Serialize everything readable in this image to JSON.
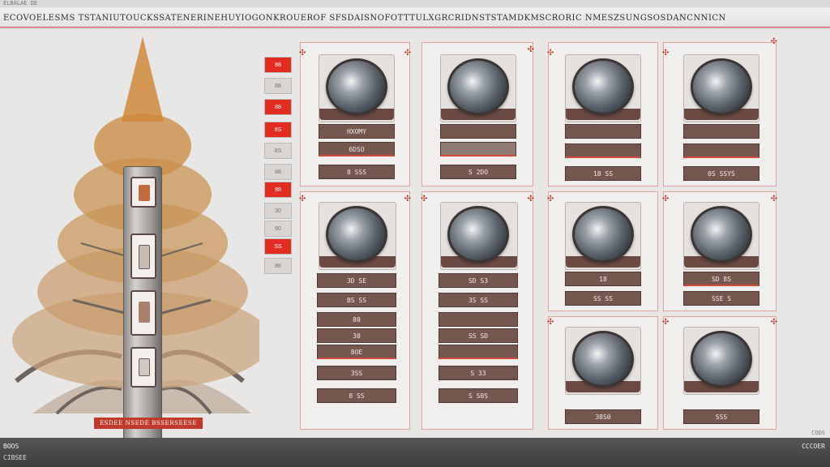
{
  "topbar": {
    "text": "ELBALAE DE"
  },
  "titlebar": {
    "title": "ECOVOELESMS TSTANIUTOUCKSSATENERINEHUYIOGONKROUEROF SFSDAISNOFOTTTULXGRCRIDNSTSTAMDKMSCRORIC NMESZSUNGSOSDANCNNICN"
  },
  "tree": {
    "caption": "ESDEE NSEDE BSSERSEESE"
  },
  "side_index": [
    "88",
    "88",
    "88",
    "8S",
    "8S",
    "88",
    "88",
    "30",
    "90",
    "SS",
    "88"
  ],
  "cards_row1": [
    {
      "rows": [
        "HXOMY",
        "6DSO",
        "8 SSS"
      ]
    },
    {
      "rows": [
        "",
        "",
        "S 2DO"
      ]
    },
    {
      "rows": [
        "",
        "",
        "18 SS"
      ]
    },
    {
      "rows": [
        "",
        "",
        "0S SSYS"
      ]
    }
  ],
  "cards_row2": [
    {
      "rows": [
        "3D SE",
        "BS SS",
        "80",
        "30",
        "8OE",
        "3SS",
        "8 SS"
      ]
    },
    {
      "rows": [
        "SD S3",
        "3S SS",
        "",
        "SS SD",
        "",
        "S 33",
        "S S0S"
      ]
    },
    {
      "rows": [
        "38S0",
        "SS SS"
      ]
    },
    {
      "rows": [
        "SD 8S",
        "SSE S"
      ]
    }
  ],
  "cards_row3": [
    {
      "rows": [
        "18"
      ]
    },
    {
      "rows": [
        "SSS"
      ]
    }
  ],
  "bottombar": {
    "left": "BOOS",
    "left2": "CIBSEE",
    "right": "CCCOER",
    "right_top": "CODS"
  },
  "colors": {
    "accent": "#e22c22",
    "row_bg": "#75574f",
    "card_border": "#e0a39a"
  }
}
